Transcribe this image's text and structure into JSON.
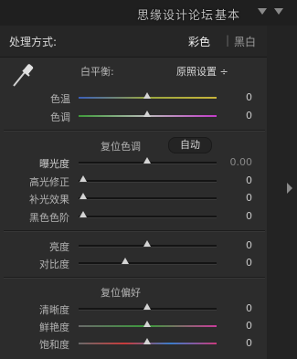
{
  "header": {
    "watermark": "思缘设计论坛",
    "watermark_extra": "基本"
  },
  "treatment": {
    "label": "处理方式:",
    "color": "彩色",
    "separator": "|",
    "bw": "黑白"
  },
  "white_balance": {
    "label": "白平衡:",
    "value": "原照设置 ÷",
    "temp": {
      "label": "色温",
      "value": "0",
      "level": 0.5
    },
    "tint": {
      "label": "色调",
      "value": "0",
      "level": 0.5
    }
  },
  "tone": {
    "label": "复位色调",
    "auto": "自动",
    "exposure": {
      "label": "曝光度",
      "value": "0.00",
      "level": 0.5
    },
    "recovery": {
      "label": "高光修正",
      "value": "0",
      "level": 0
    },
    "fill": {
      "label": "补光效果",
      "value": "0",
      "level": 0
    },
    "blacks": {
      "label": "黑色色阶",
      "value": "0",
      "level": 0
    },
    "brightness": {
      "label": "亮度",
      "value": "0",
      "level": 0.5
    },
    "contrast": {
      "label": "对比度",
      "value": "0",
      "level": 0.33
    }
  },
  "presence": {
    "label": "复位偏好",
    "clarity": {
      "label": "清晰度",
      "value": "0",
      "level": 0.5
    },
    "vibrance": {
      "label": "鲜艳度",
      "value": "0",
      "level": 0.5
    },
    "saturation": {
      "label": "饱和度",
      "value": "0",
      "level": 0.5
    }
  },
  "colors": {
    "panel_bg": "#2c2c2c",
    "header_bg": "#1f1f1f",
    "track": "#141414",
    "thumb": "#d4d4d4"
  }
}
